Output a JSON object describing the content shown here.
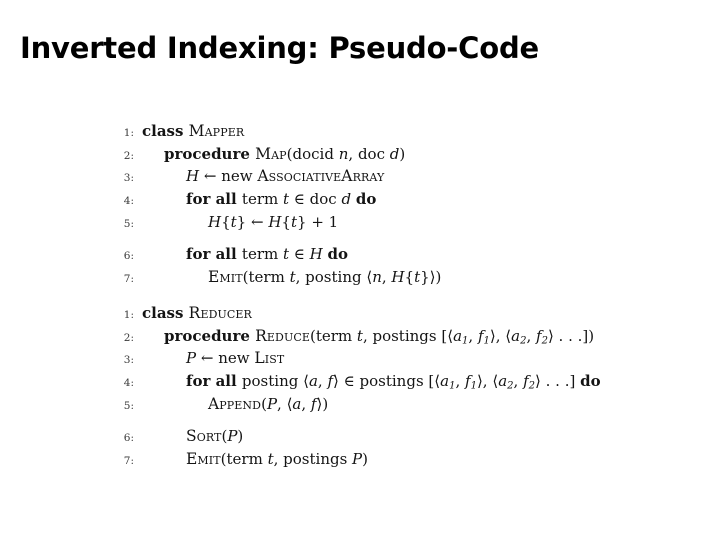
{
  "slide": {
    "title": "Inverted Indexing: Pseudo-Code",
    "background_color": "#ffffff",
    "text_color": "#000000"
  },
  "pseudocode": {
    "blocks": [
      {
        "name": "mapper",
        "lines": [
          {
            "number": "1:",
            "indent": 0,
            "gap_before": false,
            "tokens": [
              {
                "kind": "kw",
                "text": "class "
              },
              {
                "kind": "sc",
                "text": "Mapper"
              }
            ],
            "plain_text": "class Mapper"
          },
          {
            "number": "2:",
            "indent": 1,
            "gap_before": false,
            "tokens": [
              {
                "kind": "kw",
                "text": "procedure "
              },
              {
                "kind": "sc",
                "text": "Map"
              },
              {
                "kind": "plain",
                "text": "(docid "
              },
              {
                "kind": "var",
                "text": "n"
              },
              {
                "kind": "plain",
                "text": ", doc "
              },
              {
                "kind": "var",
                "text": "d"
              },
              {
                "kind": "plain",
                "text": ")"
              }
            ],
            "plain_text": "procedure Map(docid n, doc d)"
          },
          {
            "number": "3:",
            "indent": 2,
            "gap_before": false,
            "tokens": [
              {
                "kind": "var",
                "text": "H"
              },
              {
                "kind": "op",
                "text": " ← "
              },
              {
                "kind": "plain",
                "text": "new "
              },
              {
                "kind": "sc",
                "text": "AssociativeArray"
              }
            ],
            "plain_text": "H ← new AssociativeArray"
          },
          {
            "number": "4:",
            "indent": 2,
            "gap_before": false,
            "tokens": [
              {
                "kind": "kw",
                "text": "for all "
              },
              {
                "kind": "plain",
                "text": "term "
              },
              {
                "kind": "var",
                "text": "t"
              },
              {
                "kind": "op",
                "text": " ∈ "
              },
              {
                "kind": "plain",
                "text": "doc "
              },
              {
                "kind": "var",
                "text": "d"
              },
              {
                "kind": "plain",
                "text": " "
              },
              {
                "kind": "kw",
                "text": "do"
              }
            ],
            "plain_text": "for all term t ∈ doc d do"
          },
          {
            "number": "5:",
            "indent": 3,
            "gap_before": false,
            "tokens": [
              {
                "kind": "var",
                "text": "H"
              },
              {
                "kind": "plain",
                "text": "{"
              },
              {
                "kind": "var",
                "text": "t"
              },
              {
                "kind": "plain",
                "text": "}"
              },
              {
                "kind": "op",
                "text": " ← "
              },
              {
                "kind": "var",
                "text": "H"
              },
              {
                "kind": "plain",
                "text": "{"
              },
              {
                "kind": "var",
                "text": "t"
              },
              {
                "kind": "plain",
                "text": "}"
              },
              {
                "kind": "op",
                "text": " + 1"
              }
            ],
            "plain_text": "H{t} ← H{t} + 1"
          },
          {
            "number": "6:",
            "indent": 2,
            "gap_before": true,
            "tokens": [
              {
                "kind": "kw",
                "text": "for all "
              },
              {
                "kind": "plain",
                "text": "term "
              },
              {
                "kind": "var",
                "text": "t"
              },
              {
                "kind": "op",
                "text": " ∈ "
              },
              {
                "kind": "var",
                "text": "H"
              },
              {
                "kind": "plain",
                "text": " "
              },
              {
                "kind": "kw",
                "text": "do"
              }
            ],
            "plain_text": "for all term t ∈ H do"
          },
          {
            "number": "7:",
            "indent": 3,
            "gap_before": false,
            "tokens": [
              {
                "kind": "sc",
                "text": "Emit"
              },
              {
                "kind": "plain",
                "text": "(term "
              },
              {
                "kind": "var",
                "text": "t"
              },
              {
                "kind": "plain",
                "text": ", posting ⟨"
              },
              {
                "kind": "var",
                "text": "n"
              },
              {
                "kind": "plain",
                "text": ", "
              },
              {
                "kind": "var",
                "text": "H"
              },
              {
                "kind": "plain",
                "text": "{"
              },
              {
                "kind": "var",
                "text": "t"
              },
              {
                "kind": "plain",
                "text": "}⟩)"
              }
            ],
            "plain_text": "Emit(term t, posting ⟨n, H{t}⟩)"
          }
        ]
      },
      {
        "name": "reducer",
        "lines": [
          {
            "number": "1:",
            "indent": 0,
            "gap_before": false,
            "tokens": [
              {
                "kind": "kw",
                "text": "class "
              },
              {
                "kind": "sc",
                "text": "Reducer"
              }
            ],
            "plain_text": "class Reducer"
          },
          {
            "number": "2:",
            "indent": 1,
            "gap_before": false,
            "tokens": [
              {
                "kind": "kw",
                "text": "procedure "
              },
              {
                "kind": "sc",
                "text": "Reduce"
              },
              {
                "kind": "plain",
                "text": "(term "
              },
              {
                "kind": "var",
                "text": "t"
              },
              {
                "kind": "plain",
                "text": ", postings [⟨"
              },
              {
                "kind": "var",
                "text": "a"
              },
              {
                "kind": "sub",
                "text": "1"
              },
              {
                "kind": "plain",
                "text": ", "
              },
              {
                "kind": "var",
                "text": "f"
              },
              {
                "kind": "sub",
                "text": "1"
              },
              {
                "kind": "plain",
                "text": "⟩, ⟨"
              },
              {
                "kind": "var",
                "text": "a"
              },
              {
                "kind": "sub",
                "text": "2"
              },
              {
                "kind": "plain",
                "text": ", "
              },
              {
                "kind": "var",
                "text": "f"
              },
              {
                "kind": "sub",
                "text": "2"
              },
              {
                "kind": "plain",
                "text": "⟩ . . .])"
              }
            ],
            "plain_text": "procedure Reduce(term t, postings [⟨a1, f1⟩, ⟨a2, f2⟩ . . .])"
          },
          {
            "number": "3:",
            "indent": 2,
            "gap_before": false,
            "tokens": [
              {
                "kind": "var",
                "text": "P"
              },
              {
                "kind": "op",
                "text": " ← "
              },
              {
                "kind": "plain",
                "text": "new "
              },
              {
                "kind": "sc",
                "text": "List"
              }
            ],
            "plain_text": "P ← new List"
          },
          {
            "number": "4:",
            "indent": 2,
            "gap_before": false,
            "tokens": [
              {
                "kind": "kw",
                "text": "for all "
              },
              {
                "kind": "plain",
                "text": "posting ⟨"
              },
              {
                "kind": "var",
                "text": "a"
              },
              {
                "kind": "plain",
                "text": ", "
              },
              {
                "kind": "var",
                "text": "f"
              },
              {
                "kind": "plain",
                "text": "⟩"
              },
              {
                "kind": "op",
                "text": " ∈ "
              },
              {
                "kind": "plain",
                "text": "postings [⟨"
              },
              {
                "kind": "var",
                "text": "a"
              },
              {
                "kind": "sub",
                "text": "1"
              },
              {
                "kind": "plain",
                "text": ", "
              },
              {
                "kind": "var",
                "text": "f"
              },
              {
                "kind": "sub",
                "text": "1"
              },
              {
                "kind": "plain",
                "text": "⟩, ⟨"
              },
              {
                "kind": "var",
                "text": "a"
              },
              {
                "kind": "sub",
                "text": "2"
              },
              {
                "kind": "plain",
                "text": ", "
              },
              {
                "kind": "var",
                "text": "f"
              },
              {
                "kind": "sub",
                "text": "2"
              },
              {
                "kind": "plain",
                "text": "⟩ . . .] "
              },
              {
                "kind": "kw",
                "text": "do"
              }
            ],
            "plain_text": "for all posting ⟨a, f⟩ ∈ postings [⟨a1, f1⟩, ⟨a2, f2⟩ . . .] do"
          },
          {
            "number": "5:",
            "indent": 3,
            "gap_before": false,
            "tokens": [
              {
                "kind": "sc",
                "text": "Append"
              },
              {
                "kind": "plain",
                "text": "("
              },
              {
                "kind": "var",
                "text": "P"
              },
              {
                "kind": "plain",
                "text": ", ⟨"
              },
              {
                "kind": "var",
                "text": "a"
              },
              {
                "kind": "plain",
                "text": ", "
              },
              {
                "kind": "var",
                "text": "f"
              },
              {
                "kind": "plain",
                "text": "⟩)"
              }
            ],
            "plain_text": "Append(P, ⟨a, f⟩)"
          },
          {
            "number": "6:",
            "indent": 2,
            "gap_before": true,
            "tokens": [
              {
                "kind": "sc",
                "text": "Sort"
              },
              {
                "kind": "plain",
                "text": "("
              },
              {
                "kind": "var",
                "text": "P"
              },
              {
                "kind": "plain",
                "text": ")"
              }
            ],
            "plain_text": "Sort(P)"
          },
          {
            "number": "7:",
            "indent": 2,
            "gap_before": false,
            "tokens": [
              {
                "kind": "sc",
                "text": "Emit"
              },
              {
                "kind": "plain",
                "text": "(term "
              },
              {
                "kind": "var",
                "text": "t"
              },
              {
                "kind": "plain",
                "text": ",  postings "
              },
              {
                "kind": "var",
                "text": "P"
              },
              {
                "kind": "plain",
                "text": ")"
              }
            ],
            "plain_text": "Emit(term t,  postings P)"
          }
        ]
      }
    ]
  }
}
